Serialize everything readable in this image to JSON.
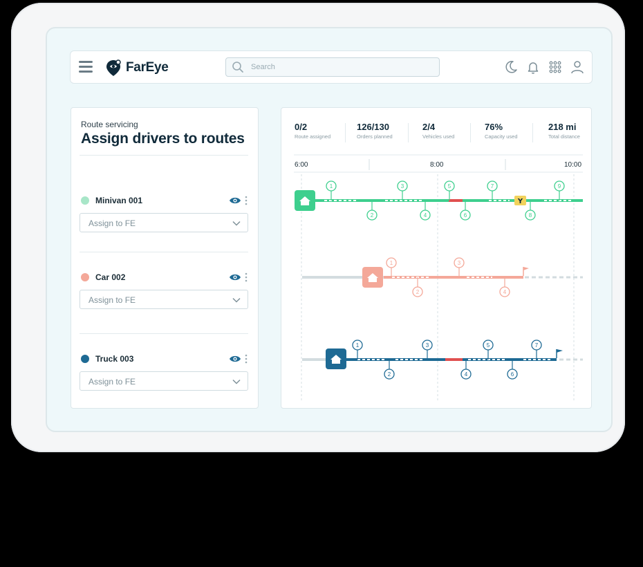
{
  "header": {
    "brand": "FarEye",
    "search_placeholder": "Search"
  },
  "left": {
    "subtitle": "Route servicing",
    "title": "Assign drivers to routes",
    "vehicles": [
      {
        "name": "Minivan 001",
        "color": "#a8e6c8",
        "select_value": "Assign to FE"
      },
      {
        "name": "Car 002",
        "color": "#f4a899",
        "select_value": "Assign to FE"
      },
      {
        "name": "Truck 003",
        "color": "#1e6a94",
        "select_value": "Assign to FE"
      }
    ]
  },
  "stats": [
    {
      "value": "0/2",
      "label": "Route assigned"
    },
    {
      "value": "126/130",
      "label": "Orders planned"
    },
    {
      "value": "2/4",
      "label": "Vehicles used"
    },
    {
      "value": "76%",
      "label": "Capacity used"
    },
    {
      "value": "218 mi",
      "label": "Total distance"
    }
  ],
  "timeline": {
    "times": [
      "6:00",
      "8:00",
      "10:00"
    ],
    "routes": [
      {
        "color": "#3ecf8e",
        "stops": [
          "1",
          "2",
          "3",
          "4",
          "5",
          "6",
          "7",
          "8",
          "9"
        ]
      },
      {
        "color": "#f4a899",
        "stops": [
          "1",
          "2",
          "3",
          "4"
        ]
      },
      {
        "color": "#1e6a94",
        "stops": [
          "1",
          "2",
          "3",
          "4",
          "5",
          "6",
          "7"
        ]
      }
    ]
  },
  "colors": {
    "delay": "#e05050",
    "break": "#f2d25c"
  }
}
